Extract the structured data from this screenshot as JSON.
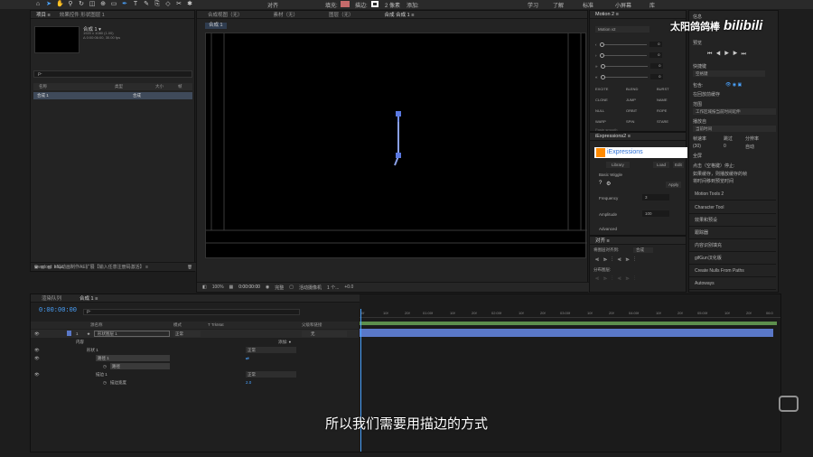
{
  "toolbar": {
    "align_label": "对齐",
    "fill_label": "填充:",
    "stroke_label": "描边:",
    "stroke_px": "2 像素",
    "add_label": "添加:",
    "workspaces": [
      "学习",
      "了解",
      "标准",
      "小屏幕",
      "库"
    ],
    "colors": {
      "fill": "#c56a6a",
      "stroke": "#ffffff"
    }
  },
  "project": {
    "tabs": [
      "项目 ≡",
      "效果控件 形状图层 1"
    ],
    "item_name": "合成 1 ▾",
    "item_info": "1920 x 1080 (1.00)\nΔ 0:00:06:00, 30.00 fps",
    "search_placeholder": "ρ-",
    "columns": [
      "名称",
      "类型",
      "大小",
      "帧"
    ],
    "row": {
      "name": "合成 1",
      "type": "合成"
    },
    "footer_bpc": "8 bpc"
  },
  "overlord": "Overlord: MG动画制作AE扩展【输入任意注册码激活】 ≡",
  "viewer": {
    "tabs": [
      "合成视图（无）",
      "素材（无）",
      "图层（无）",
      "合成 合成 1 ≡"
    ],
    "comp_chip": "合成 1",
    "zoom": "100%",
    "timecode": "0:00:00:00",
    "resolution": "完整",
    "camera": "活动摄像机",
    "views": "1 个...",
    "exposure": "+0.0"
  },
  "motion": {
    "title": "Motion 2 ≡",
    "version": "Motion v2",
    "values": [
      "0",
      "0",
      "0",
      "0"
    ],
    "buttons": [
      "EXCITE",
      "BLEND",
      "BURST",
      "CLONE",
      "JUMP",
      "NAME",
      "NULL",
      "ORBIT",
      "ROPE",
      "WARP",
      "SPIN",
      "STARE"
    ],
    "footer": "Paste smooth"
  },
  "iexpressions": {
    "title": "iExpressions2 ≡",
    "logo": "iExpressions",
    "tabs": [
      "Library",
      "Load",
      "Edit"
    ],
    "preset": "Basic Wiggle",
    "apply": "Apply",
    "params": [
      {
        "name": "Frequency",
        "value": "3"
      },
      {
        "name": "Amplitude",
        "value": "100"
      }
    ],
    "advanced": "Advanced"
  },
  "align": {
    "title": "对齐 ≡",
    "align_to_label": "将图层对齐到:",
    "align_to_value": "合成",
    "distribute_label": "分布图层:"
  },
  "preview": {
    "info_tab": "信息",
    "preview_tab": "预览",
    "shortcut_label": "快捷键",
    "shortcut_value": "空格键",
    "include_label": "包含:",
    "cache_label": "在回放前缓存",
    "range_label": "范围",
    "range_value": "工作区域按当前时间延伸",
    "play_from_label": "播放自",
    "play_from_value": "当前时间",
    "fps_label": "帧速率",
    "skip_label": "跳过",
    "res_label": "分辨率",
    "fps_value": "(30)",
    "skip_value": "0",
    "res_value": "自动",
    "fullscreen": "全屏",
    "stop_label": "点击（空格键）停止:",
    "stop_opt1": "如果缓存，则播放缓存的帧",
    "stop_opt2": "将时间移到预览时间",
    "panels": [
      "Motion Tools 2",
      "Character Tool",
      "效果和预设",
      "跟踪器",
      "内容识别填充",
      "gifGun汉化版",
      "Create Nulls From Paths",
      "Autoways"
    ]
  },
  "timeline": {
    "tabs": [
      "渲染队列",
      "合成 1 ≡"
    ],
    "timecode": "0:00:00:00",
    "search_placeholder": "ρ-",
    "columns": [
      "源名称",
      "模式",
      "T TrkMat",
      "父级和链接"
    ],
    "layer": {
      "index": "1",
      "name": "形状图层 1",
      "mode": "正常",
      "parent": "无"
    },
    "rows": [
      {
        "label": "内容",
        "value": "添加: ●"
      },
      {
        "label": "形状 1",
        "value": "正常"
      },
      {
        "label": "路径 1",
        "value": ""
      },
      {
        "label": "路径",
        "value": ""
      },
      {
        "label": "描边 1",
        "value": "正常"
      },
      {
        "label": "描边宽度",
        "value": "2.0"
      }
    ],
    "ruler_ticks": [
      "0f",
      "10f",
      "20f",
      "01:00f",
      "10f",
      "20f",
      "02:00f",
      "10f",
      "20f",
      "03:00f",
      "10f",
      "20f",
      "04:00f",
      "10f",
      "20f",
      "05:00f",
      "10f",
      "20f",
      "06:0"
    ]
  },
  "subtitle": "所以我们需要用描边的方式",
  "watermark": {
    "name": "太阳鸽鸽棒",
    "brand": "bilibili"
  }
}
